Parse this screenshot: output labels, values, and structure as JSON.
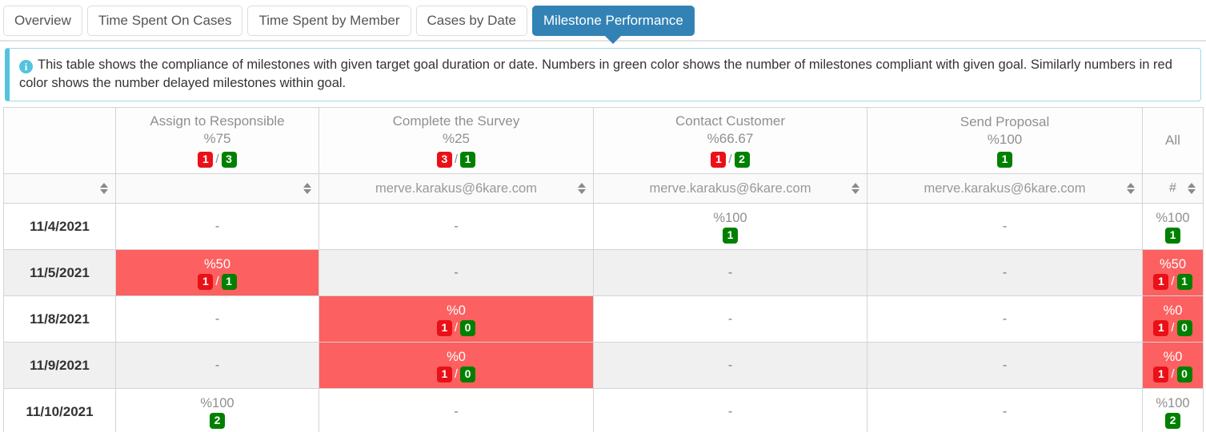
{
  "tabs": [
    {
      "label": "Overview",
      "active": false
    },
    {
      "label": "Time Spent On Cases",
      "active": false
    },
    {
      "label": "Time Spent by Member",
      "active": false
    },
    {
      "label": "Cases by Date",
      "active": false
    },
    {
      "label": "Milestone Performance",
      "active": true
    }
  ],
  "banner": {
    "icon": "info-circle-icon",
    "text": "This table shows the compliance of milestones with given target goal duration or date. Numbers in green color shows the number of milestones compliant with given goal. Similarly numbers in red color shows the number delayed milestones within goal."
  },
  "colors": {
    "accent": "#3382b5",
    "info_border": "#55c3e0",
    "badge_red": "#ea1017",
    "badge_green": "#008000",
    "cell_red": "#fc6060",
    "row_stripe": "#f0f0f0"
  },
  "table": {
    "columns": [
      {
        "title": "",
        "pct": "",
        "red": null,
        "green": null,
        "filter": "",
        "sortable": true
      },
      {
        "title": "Assign to Responsible",
        "pct": "%75",
        "red": "1",
        "green": "3",
        "filter": "",
        "sortable": true
      },
      {
        "title": "Complete the Survey",
        "pct": "%25",
        "red": "3",
        "green": "1",
        "filter": "merve.karakus@6kare.com",
        "sortable": true
      },
      {
        "title": "Contact Customer",
        "pct": "%66.67",
        "red": "1",
        "green": "2",
        "filter": "merve.karakus@6kare.com",
        "sortable": true
      },
      {
        "title": "Send Proposal",
        "pct": "%100",
        "red": null,
        "green": "1",
        "filter": "merve.karakus@6kare.com",
        "sortable": true
      },
      {
        "title": "All",
        "pct": "",
        "red": null,
        "green": null,
        "filter": "#",
        "sortable": true
      }
    ],
    "rows": [
      {
        "date": "11/4/2021",
        "cells": [
          {
            "pct": "",
            "red": null,
            "green": null,
            "dash": "-",
            "highlight": false
          },
          {
            "pct": "",
            "red": null,
            "green": null,
            "dash": "-",
            "highlight": false
          },
          {
            "pct": "%100",
            "red": null,
            "green": "1",
            "dash": "",
            "highlight": false
          },
          {
            "pct": "",
            "red": null,
            "green": null,
            "dash": "-",
            "highlight": false
          },
          {
            "pct": "%100",
            "red": null,
            "green": "1",
            "dash": "",
            "highlight": false
          }
        ]
      },
      {
        "date": "11/5/2021",
        "cells": [
          {
            "pct": "%50",
            "red": "1",
            "green": "1",
            "dash": "",
            "highlight": true
          },
          {
            "pct": "",
            "red": null,
            "green": null,
            "dash": "-",
            "highlight": false
          },
          {
            "pct": "",
            "red": null,
            "green": null,
            "dash": "-",
            "highlight": false
          },
          {
            "pct": "",
            "red": null,
            "green": null,
            "dash": "-",
            "highlight": false
          },
          {
            "pct": "%50",
            "red": "1",
            "green": "1",
            "dash": "",
            "highlight": true
          }
        ]
      },
      {
        "date": "11/8/2021",
        "cells": [
          {
            "pct": "",
            "red": null,
            "green": null,
            "dash": "-",
            "highlight": false
          },
          {
            "pct": "%0",
            "red": "1",
            "green": "0",
            "dash": "",
            "highlight": true
          },
          {
            "pct": "",
            "red": null,
            "green": null,
            "dash": "-",
            "highlight": false
          },
          {
            "pct": "",
            "red": null,
            "green": null,
            "dash": "-",
            "highlight": false
          },
          {
            "pct": "%0",
            "red": "1",
            "green": "0",
            "dash": "",
            "highlight": true
          }
        ]
      },
      {
        "date": "11/9/2021",
        "cells": [
          {
            "pct": "",
            "red": null,
            "green": null,
            "dash": "-",
            "highlight": false
          },
          {
            "pct": "%0",
            "red": "1",
            "green": "0",
            "dash": "",
            "highlight": true
          },
          {
            "pct": "",
            "red": null,
            "green": null,
            "dash": "-",
            "highlight": false
          },
          {
            "pct": "",
            "red": null,
            "green": null,
            "dash": "-",
            "highlight": false
          },
          {
            "pct": "%0",
            "red": "1",
            "green": "0",
            "dash": "",
            "highlight": true
          }
        ]
      },
      {
        "date": "11/10/2021",
        "cells": [
          {
            "pct": "%100",
            "red": null,
            "green": "2",
            "dash": "",
            "highlight": false
          },
          {
            "pct": "",
            "red": null,
            "green": null,
            "dash": "-",
            "highlight": false
          },
          {
            "pct": "",
            "red": null,
            "green": null,
            "dash": "-",
            "highlight": false
          },
          {
            "pct": "",
            "red": null,
            "green": null,
            "dash": "-",
            "highlight": false
          },
          {
            "pct": "%100",
            "red": null,
            "green": "2",
            "dash": "",
            "highlight": false
          }
        ]
      }
    ]
  }
}
